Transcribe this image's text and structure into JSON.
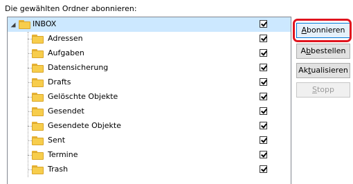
{
  "caption": "Die gewählten Ordner abonnieren:",
  "tree": {
    "root": {
      "label": "INBOX",
      "checked": true
    },
    "children": [
      {
        "label": "Adressen",
        "checked": true
      },
      {
        "label": "Aufgaben",
        "checked": true
      },
      {
        "label": "Datensicherung",
        "checked": true
      },
      {
        "label": "Drafts",
        "checked": true
      },
      {
        "label": "Gelöschte Objekte",
        "checked": true
      },
      {
        "label": "Gesendet",
        "checked": true
      },
      {
        "label": "Gesendete Objekte",
        "checked": true
      },
      {
        "label": "Sent",
        "checked": true
      },
      {
        "label": "Termine",
        "checked": true
      },
      {
        "label": "Trash",
        "checked": true
      }
    ]
  },
  "buttons": {
    "subscribe": {
      "pre": "",
      "key": "A",
      "post": "bonnieren"
    },
    "unsubscribe": {
      "pre": "A",
      "key": "b",
      "post": "bestellen"
    },
    "refresh": {
      "pre": "Ak",
      "key": "t",
      "post": "ualisieren"
    },
    "stop": {
      "pre": "",
      "key": "S",
      "post": "topp"
    }
  },
  "colors": {
    "selection": "#cce8ff",
    "highlight_ring": "#e0141e",
    "folder": "#f7cd4c"
  },
  "icons": {
    "expander": "expand-triangle-icon",
    "folder": "folder-icon",
    "check": "checkbox-checked-icon"
  }
}
